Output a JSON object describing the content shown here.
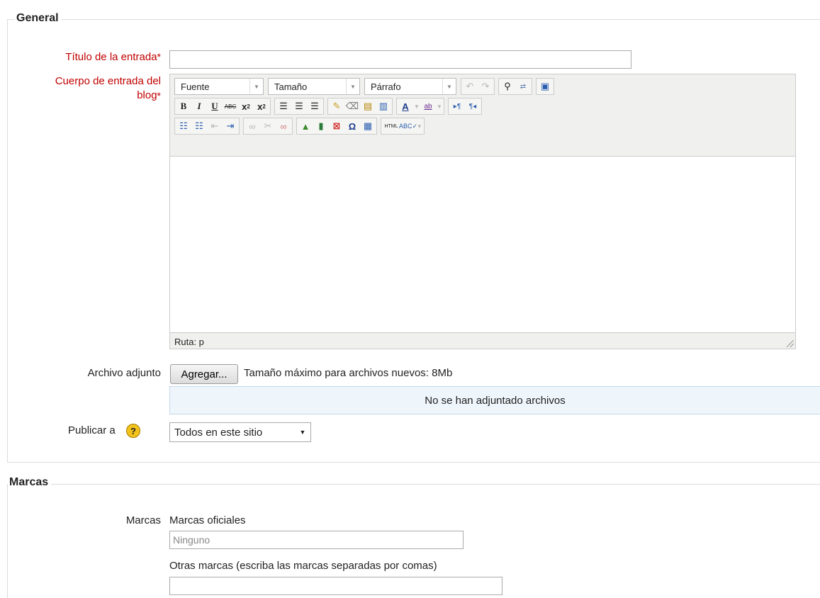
{
  "general": {
    "legend": "General",
    "title_label": "Título de la entrada",
    "body_label_line1": "Cuerpo de entrada del",
    "body_label_line2": "blog",
    "required_mark": "*",
    "title_value": "",
    "editor": {
      "font_select": "Fuente",
      "size_select": "Tamaño",
      "format_select": "Párrafo",
      "path_label": "Ruta: p",
      "content": ""
    },
    "attachment_label": "Archivo adjunto",
    "add_button": "Agregar...",
    "max_size_text": "Tamaño máximo para archivos nuevos: 8Mb",
    "no_files_text": "No se han adjuntado archivos",
    "publish_label": "Publicar a",
    "publish_value": "Todos en este sitio"
  },
  "marcas": {
    "legend": "Marcas",
    "label": "Marcas",
    "official_label": "Marcas oficiales",
    "official_value": "Ninguno",
    "other_label": "Otras marcas (escriba las marcas separadas por comas)"
  }
}
